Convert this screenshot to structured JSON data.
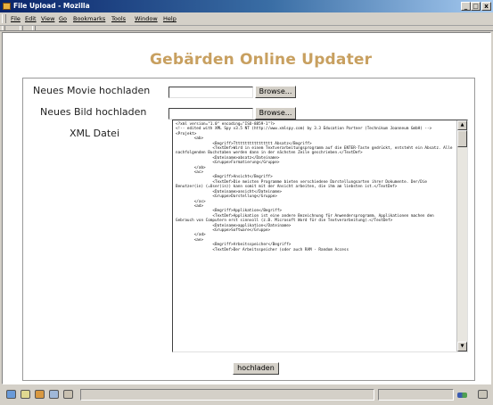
{
  "window": {
    "title": "File Upload - Mozilla",
    "controls": {
      "minimize": "_",
      "maximize": "□",
      "close": "x"
    }
  },
  "menu": {
    "items": [
      "File",
      "Edit",
      "View",
      "Go",
      "Bookmarks",
      "Tools",
      "Window",
      "Help"
    ]
  },
  "page": {
    "heading": "Gebärden Online Updater",
    "movie_label": "Neues Movie hochladen",
    "movie_value": "",
    "image_label": "Neues Bild hochladen",
    "image_value": "",
    "browse_label": "Browse...",
    "xml_label": "XML Datei",
    "xml_content": "<?xml version=\"1.0\" encoding=\"ISO-8859-1\"?>\n<!-- edited with XML Spy v3.5 NT (http://www.xmlspy.com) by 3.3 Education Partner (Technikum Joanneum GmbH) -->\n<Projekt>\n        <ab>\n                <Begriff>Ttttttttttttttttt Absatz</Begriff>\n                <TextDef>Wird in einem Textverarbeitungsprogramm auf die ENTER-Taste gedrückt, entsteht ein Absatz. Alle nachfolgenden Buchstaben werden dann in der nächsten Zeile geschrieben.</TextDef>\n                <Dateiname>absatz</Dateiname>\n                <Gruppe>Formatierung</Gruppe>\n        </ab>\n        <ac>\n                <Begriff>Ansicht</Begriff>\n                <TextDef>Die meisten Programme bieten verschiedene Darstellungsarten ihrer Dokumente. Der/Die Benutzer(in) (=User(in)) kann somit mit der Ansicht arbeiten, die ihm am liebsten ist.</TextDef>\n                <Dateiname>ansicht</Dateiname>\n                <Gruppe>Darstellung</Gruppe>\n        </ac>\n        <ad>\n                <Begriff>Applikation</Begriff>\n                <TextDef>Applikation ist eine andere Bezeichnung für Anwendersprogramm. Applikationen machen den Gebrauch von Computern erst sinnvoll (z.B. Microsoft Word für die Textverarbeitung).</TextDef>\n                <Dateiname>applikation</Dateiname>\n                <Gruppe>Software</Gruppe>\n        </ad>\n        <ae>\n                <Begriff>Arbeitsspeicher</Begriff>\n                <TextDef>Der Arbeitsspeicher (oder auch RAM - Random Access",
    "submit_label": "hochladen"
  },
  "status": {
    "icons": [
      "navigator-icon",
      "mail-icon",
      "composer-icon",
      "address-book-icon",
      "chat-icon"
    ],
    "right_icons": [
      "online-icon",
      "security-icon"
    ]
  }
}
